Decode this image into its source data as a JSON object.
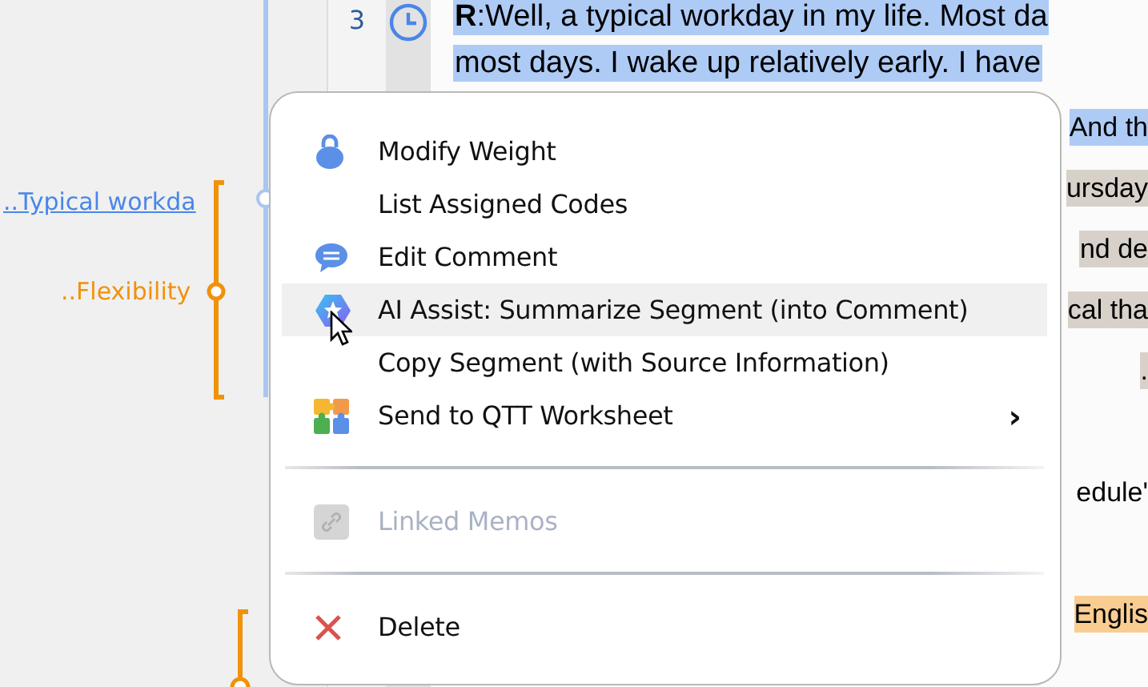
{
  "codes": [
    {
      "label": "..Typical workda",
      "kind": "link",
      "color": "#4a86e8"
    },
    {
      "label": "..Flexibility",
      "kind": "plain",
      "color": "#f0920a"
    }
  ],
  "document": {
    "line_number": "3",
    "lines": [
      {
        "kind": "full",
        "text": "**R**:Well, a typical workday in my life. Most da",
        "color": "#aecbf6"
      },
      {
        "kind": "full",
        "text": "most days. I wake up relatively early. I have",
        "color": "#aecbf6"
      },
      {
        "kind": "fragment",
        "text": "And th",
        "color": "#aecbf6"
      },
      {
        "kind": "fragment",
        "text": "ursday",
        "color": "#d8d1ca"
      },
      {
        "kind": "fragment",
        "text": "nd de",
        "color": "#d8d1ca"
      },
      {
        "kind": "fragment",
        "text": "cal tha",
        "color": "#d8d1ca"
      },
      {
        "kind": "fragment",
        "text": ".",
        "color": "#d8d1ca"
      },
      {
        "kind": "blank"
      },
      {
        "kind": "fragment",
        "text": "edule'"
      },
      {
        "kind": "blank"
      },
      {
        "kind": "fragment",
        "text": "Englis",
        "color": "#f9cd92"
      }
    ]
  },
  "context_menu": {
    "items": [
      {
        "kind": "item",
        "label": "Modify Weight",
        "highlighted": false,
        "disabled": false
      },
      {
        "kind": "item",
        "label": "List Assigned Codes",
        "highlighted": false,
        "disabled": false
      },
      {
        "kind": "item",
        "label": "Edit Comment",
        "highlighted": false,
        "disabled": false
      },
      {
        "kind": "item",
        "label": "AI Assist: Summarize Segment (into Comment)",
        "highlighted": true,
        "disabled": false
      },
      {
        "kind": "item",
        "label": "Copy Segment (with Source Information)",
        "highlighted": false,
        "disabled": false
      },
      {
        "kind": "item",
        "label": "Send to QTT Worksheet",
        "highlighted": false,
        "disabled": false,
        "submenu_mark": "›"
      },
      {
        "kind": "separator"
      },
      {
        "kind": "item",
        "label": "Linked Memos",
        "highlighted": false,
        "disabled": true
      },
      {
        "kind": "separator"
      },
      {
        "kind": "item",
        "label": "Delete",
        "highlighted": false,
        "disabled": false
      }
    ]
  }
}
